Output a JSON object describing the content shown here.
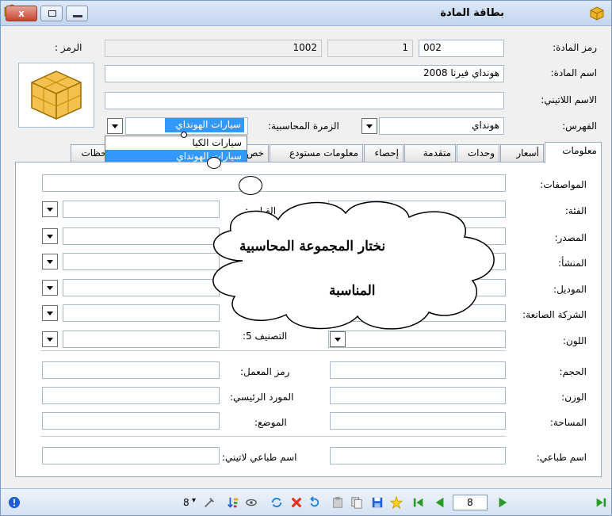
{
  "window": {
    "title": "بطاقة المادة",
    "close_label": "x"
  },
  "header": {
    "code_label": "رمز المادة:",
    "code_value": "002",
    "code_sep": "1",
    "code_full": "1002",
    "symbol_label": "الرمز :",
    "name_label": "اسم المادة:",
    "name_value": "هونداي فيرنا 2008",
    "latin_label": "الاسم اللاتيني:",
    "latin_value": "",
    "index_label": "الفهرس:",
    "index_value": "هونداي",
    "account_group_label": "الزمرة المحاسبية:",
    "account_group_value": "سيارات الهونداي",
    "account_group_options": [
      "سيارات الكيا",
      "سيارات الهونداي"
    ]
  },
  "tabs": [
    "معلومات",
    "أسعار",
    "وحدات",
    "متقدمة",
    "إحصاء",
    "معلومات مستودع",
    "خص",
    "احظات"
  ],
  "form": {
    "specs_label": "المواصفات:",
    "category_label": "الفئة:",
    "measure_label": "القياس:",
    "source_label": "المصدر:",
    "origin_label": "المنشأ:",
    "model_label": "الموديل:",
    "maker_label": "الشركة الصانعة:",
    "color_label": "اللون:",
    "class5_label": "التصنيف 5:",
    "volume_label": "الحجم:",
    "lab_code_label": "رمز المعمل:",
    "weight_label": "الوزن:",
    "main_supplier_label": "المورد الرئيسي:",
    "area_label": "المساحة:",
    "position_label": "الموضع:",
    "print_name_label": "اسم طباعي:",
    "print_latin_label": "اسم طباعي لاتيني:"
  },
  "callout": {
    "line1": "نختار المجموعة المحاسبية",
    "line2": "المناسبة"
  },
  "statusbar": {
    "record_number": "8",
    "copies_count": "8"
  }
}
